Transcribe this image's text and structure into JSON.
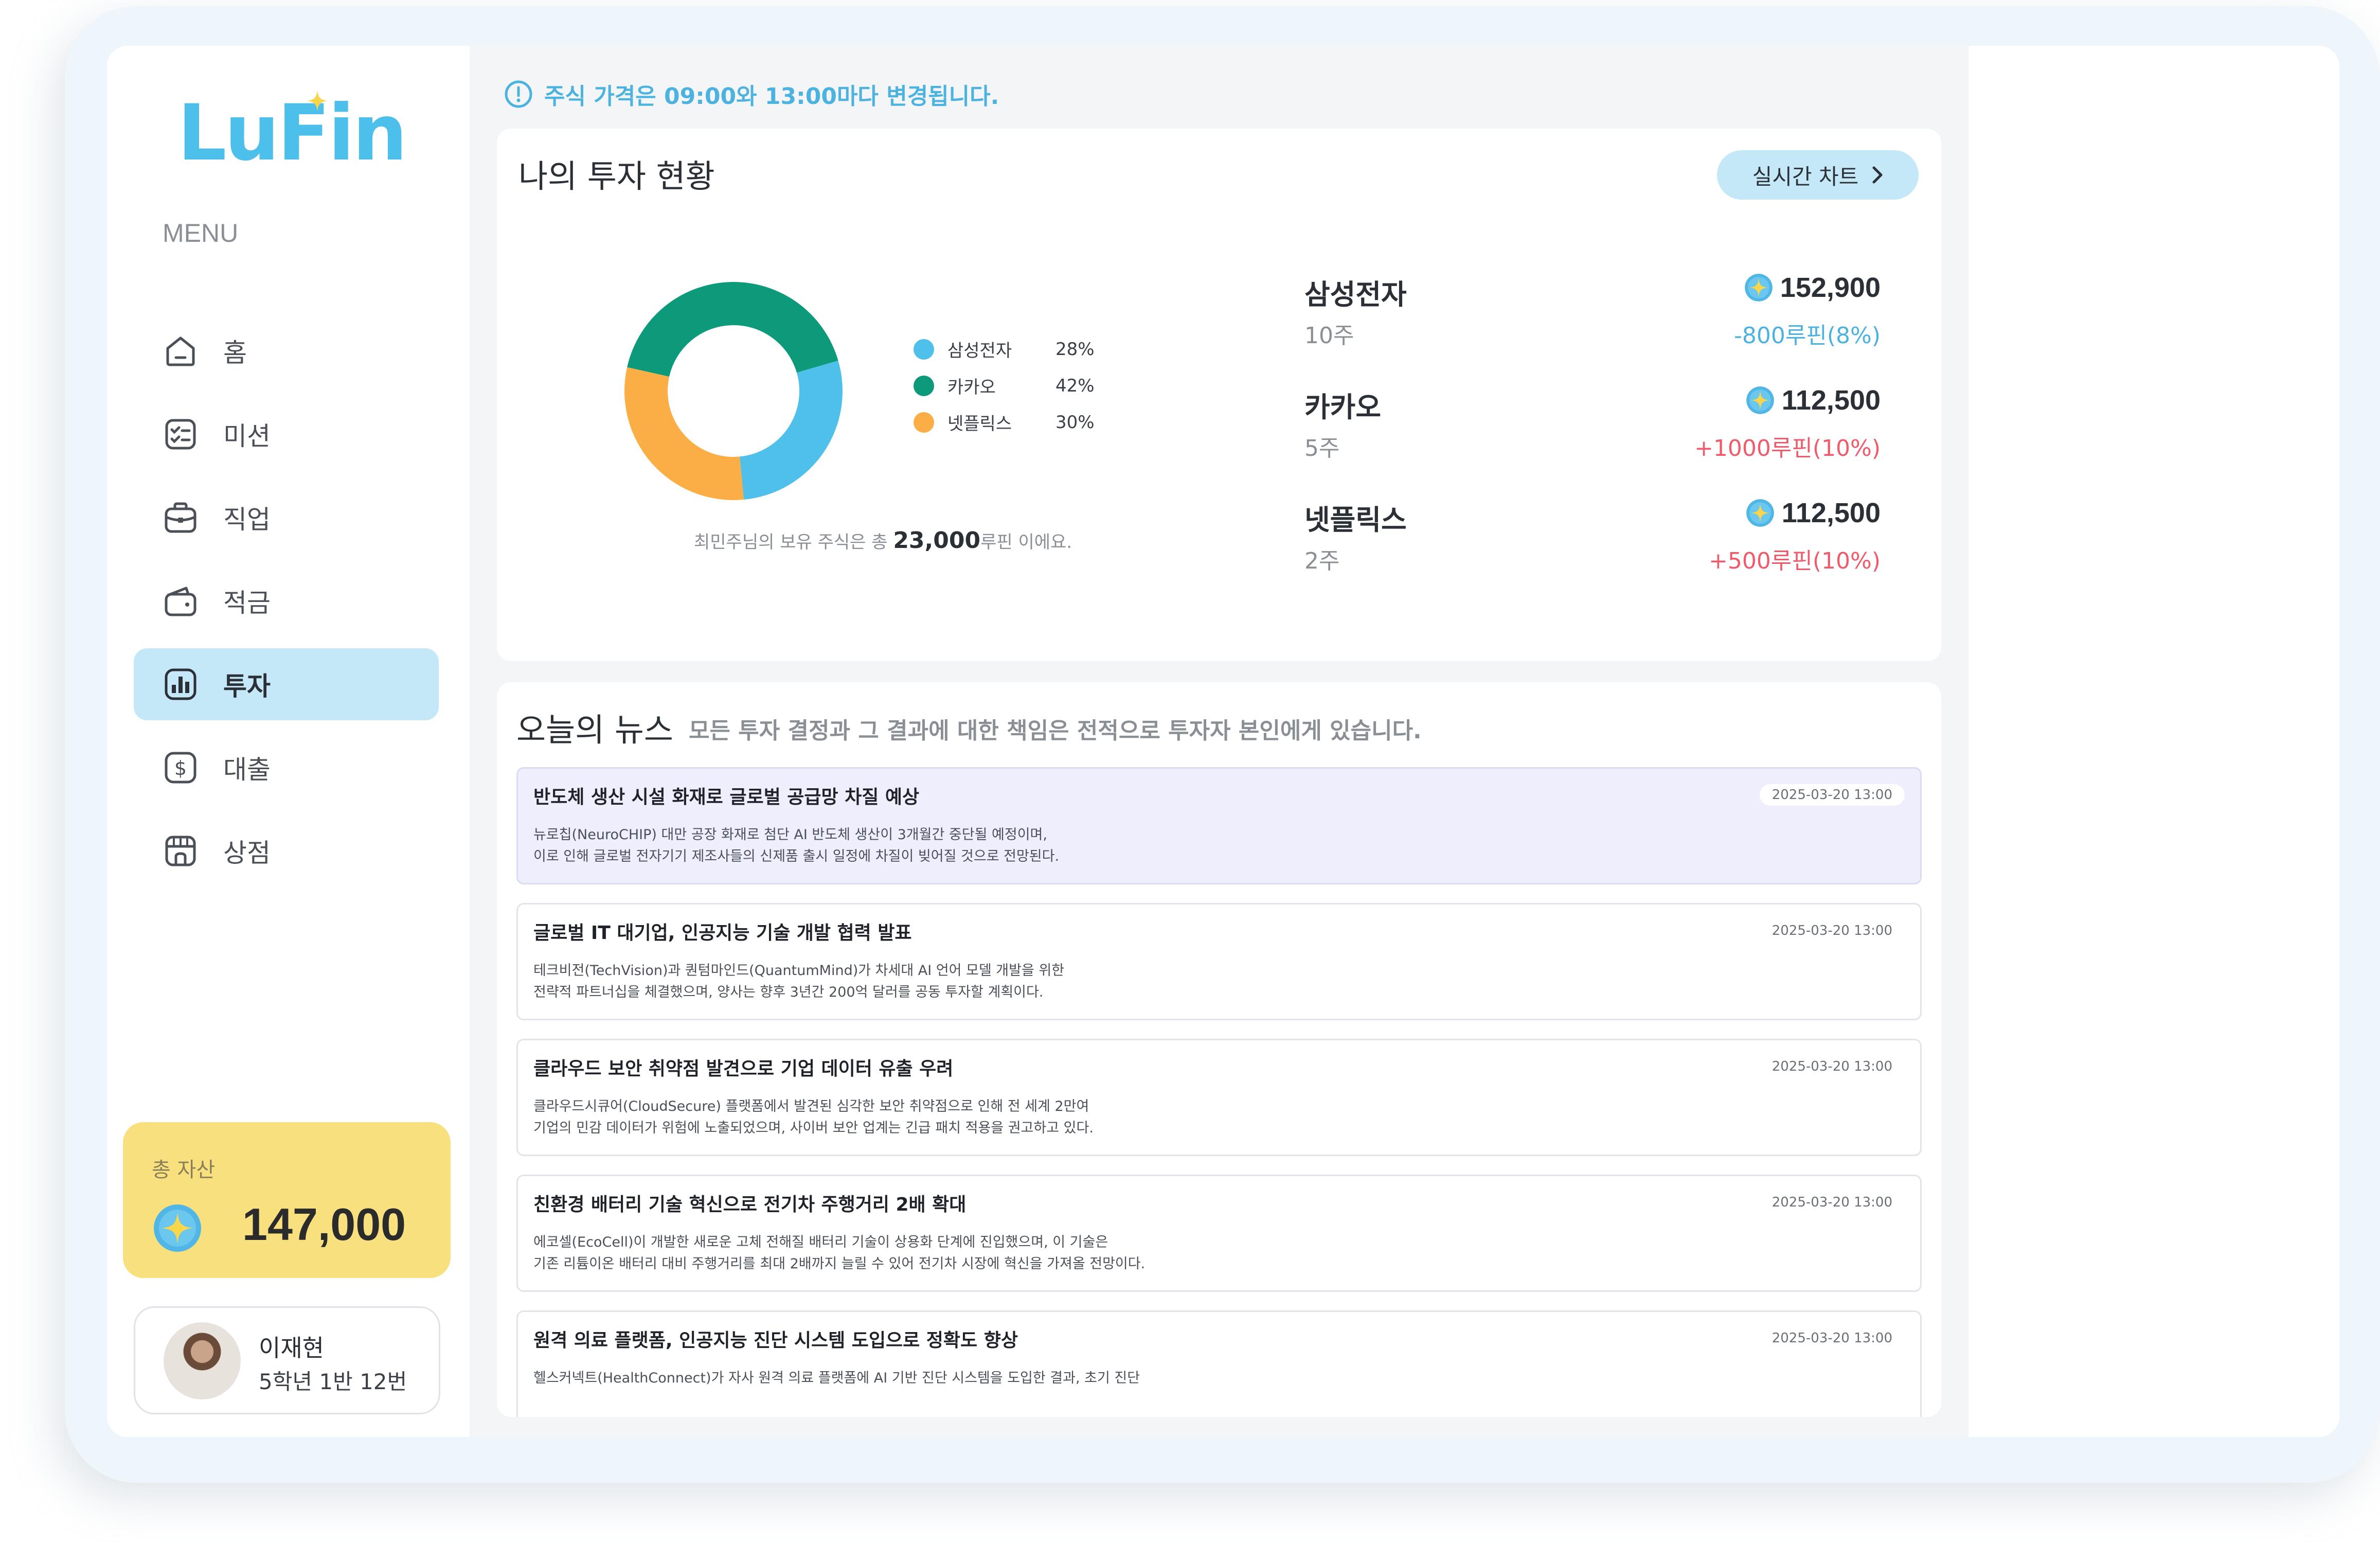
{
  "app": {
    "logo": "LuFin",
    "menu_label": "MENU"
  },
  "sidebar": {
    "items": [
      {
        "label": "홈",
        "icon": "home-icon",
        "active": false
      },
      {
        "label": "미션",
        "icon": "checklist-icon",
        "active": false
      },
      {
        "label": "직업",
        "icon": "briefcase-icon",
        "active": false
      },
      {
        "label": "적금",
        "icon": "wallet-icon",
        "active": false
      },
      {
        "label": "투자",
        "icon": "chart-icon",
        "active": true
      },
      {
        "label": "대출",
        "icon": "dollar-icon",
        "active": false
      },
      {
        "label": "상점",
        "icon": "store-icon",
        "active": false
      }
    ]
  },
  "assets": {
    "title": "총 자산",
    "value": "147,000"
  },
  "profile": {
    "name": "이재현",
    "class_info": "5학년 1반 12번"
  },
  "notice": "주식 가격은 09:00와 13:00마다 변경됩니다.",
  "portfolio": {
    "title": "나의 투자 현황",
    "chart_button": "실시간 차트",
    "holding_prefix": "최민주님의 보유 주식은 총 ",
    "holding_amount": "23,000",
    "holding_suffix": "루핀 이에요.",
    "stocks": [
      {
        "name": "삼성전자",
        "qty": "10주",
        "price": "152,900",
        "change": "-800루핀(8%)",
        "direction": "down"
      },
      {
        "name": "카카오",
        "qty": "5주",
        "price": "112,500",
        "change": "+1000루핀(10%)",
        "direction": "up"
      },
      {
        "name": "넷플릭스",
        "qty": "2주",
        "price": "112,500",
        "change": "+500루핀(10%)",
        "direction": "up"
      }
    ]
  },
  "chart_data": {
    "type": "pie",
    "categories": [
      "삼성전자",
      "카카오",
      "넷플릭스"
    ],
    "values": [
      28,
      42,
      30
    ],
    "labels": [
      "28%",
      "42%",
      "30%"
    ],
    "colors": [
      "#4fc0ea",
      "#0d9a7a",
      "#fbae45"
    ],
    "legend": "right"
  },
  "news": {
    "title": "오늘의 뉴스",
    "disclaimer": "모든 투자 결정과 그 결과에 대한 책임은 전적으로 투자자 본인에게 있습니다.",
    "items": [
      {
        "headline": "반도체 생산 시설 화재로 글로벌 공급망 차질 예상",
        "date": "2025-03-20 13:00",
        "line1": "뉴로칩(NeuroCHIP) 대만 공장 화재로 첨단 AI 반도체 생산이 3개월간 중단될 예정이며,",
        "line2": "이로 인해 글로벌 전자기기 제조사들의 신제품 출시 일정에 차질이 빚어질 것으로 전망된다."
      },
      {
        "headline": "글로벌 IT 대기업, 인공지능 기술 개발 협력 발표",
        "date": "2025-03-20 13:00",
        "line1": "테크비전(TechVision)과 퀀텀마인드(QuantumMind)가 차세대 AI 언어 모델 개발을 위한",
        "line2": "전략적 파트너십을 체결했으며, 양사는 향후 3년간 200억 달러를 공동 투자할 계획이다."
      },
      {
        "headline": "클라우드 보안 취약점 발견으로 기업 데이터 유출 우려",
        "date": "2025-03-20 13:00",
        "line1": "클라우드시큐어(CloudSecure) 플랫폼에서 발견된 심각한 보안 취약점으로 인해 전 세계 2만여",
        "line2": "기업의 민감 데이터가 위험에 노출되었으며, 사이버 보안 업계는 긴급 패치 적용을 권고하고 있다."
      },
      {
        "headline": "친환경 배터리 기술 혁신으로 전기차 주행거리 2배 확대",
        "date": "2025-03-20 13:00",
        "line1": "에코셀(EcoCell)이 개발한 새로운 고체 전해질 배터리 기술이 상용화 단계에 진입했으며, 이 기술은",
        "line2": "기존 리튬이온 배터리 대비 주행거리를 최대 2배까지 늘릴 수 있어 전기차 시장에 혁신을 가져올 전망이다."
      },
      {
        "headline": "원격 의료 플랫폼, 인공지능 진단 시스템 도입으로 정확도 향상",
        "date": "2025-03-20 13:00",
        "line1": "헬스커넥트(HealthConnect)가 자사 원격 의료 플랫폼에 AI 기반 진단 시스템을 도입한 결과, 초기 진단",
        "line2": ""
      }
    ]
  }
}
